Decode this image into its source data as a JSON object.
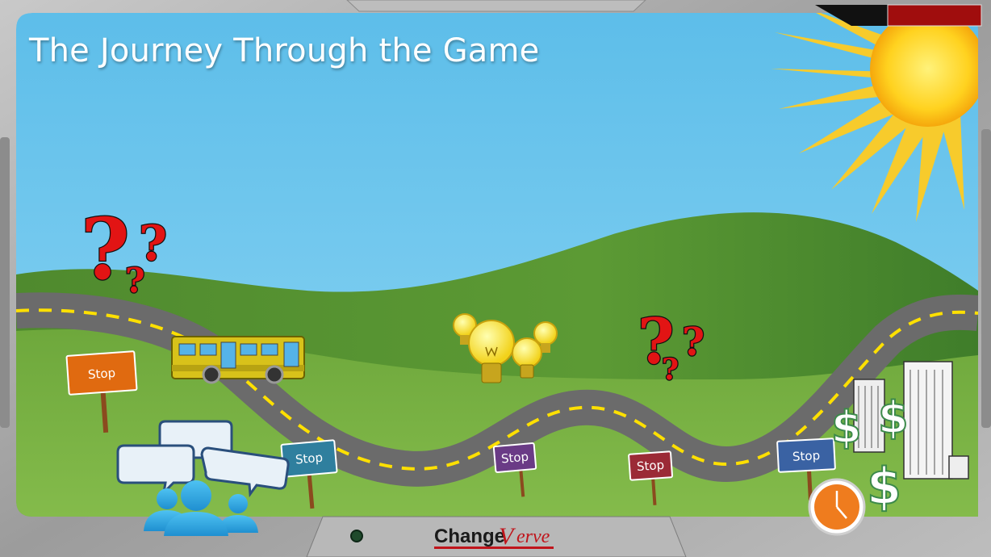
{
  "slide": {
    "title": "The Journey Through the Game"
  },
  "stop_signs": [
    {
      "label": "Stop",
      "color": "#e06a10"
    },
    {
      "label": "Stop",
      "color": "#2f7f9e"
    },
    {
      "label": "Stop",
      "color": "#6a3b86"
    },
    {
      "label": "Stop",
      "color": "#9b2a36"
    },
    {
      "label": "Stop",
      "color": "#3a62a3"
    }
  ],
  "question_marks": {
    "glyph": "?"
  },
  "dollar_signs": {
    "glyph": "$"
  },
  "logo": {
    "prefix": "Change",
    "initial": "V",
    "suffix": "erve",
    "colors": {
      "dark": "#1a1a1a",
      "accent": "#c0141b"
    }
  },
  "colors": {
    "sky": "#6cc6ef",
    "hill": "#76ad3e",
    "road": "#6b6b6b",
    "road_line": "#ffe000",
    "frame": "#a7a7a7"
  },
  "icons": [
    "sun-icon",
    "bus-icon",
    "lightbulb-icon",
    "speech-bubble-icon",
    "people-icon",
    "building-icon",
    "dollar-sign-icon",
    "clock-icon",
    "question-mark-icon"
  ]
}
